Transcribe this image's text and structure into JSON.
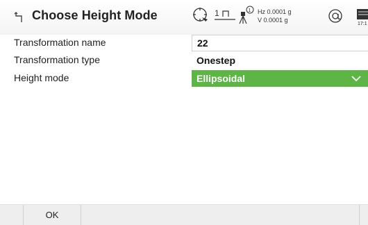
{
  "header": {
    "title": "Choose Height Mode",
    "status": {
      "tracking_icon": "crosshair-target-icon",
      "face_icon": "face-i-icon",
      "face_label": "1",
      "instrument_icon": "instrument-height-icon",
      "hz": "Hz 0.0001 g",
      "v": "V  0.0001 g",
      "prism_icon": "reflector-at-icon",
      "battery_icon": "battery-icon",
      "time": "17:1"
    }
  },
  "form": {
    "rows": [
      {
        "label": "Transformation name",
        "value": "22"
      },
      {
        "label": "Transformation type",
        "value": "Onestep"
      },
      {
        "label": "Height mode",
        "value": "Ellipsoidal"
      }
    ]
  },
  "softkeys": {
    "f1": "OK"
  },
  "colors": {
    "accent": "#5cb545",
    "softkey_bar": "#eeeeee"
  }
}
